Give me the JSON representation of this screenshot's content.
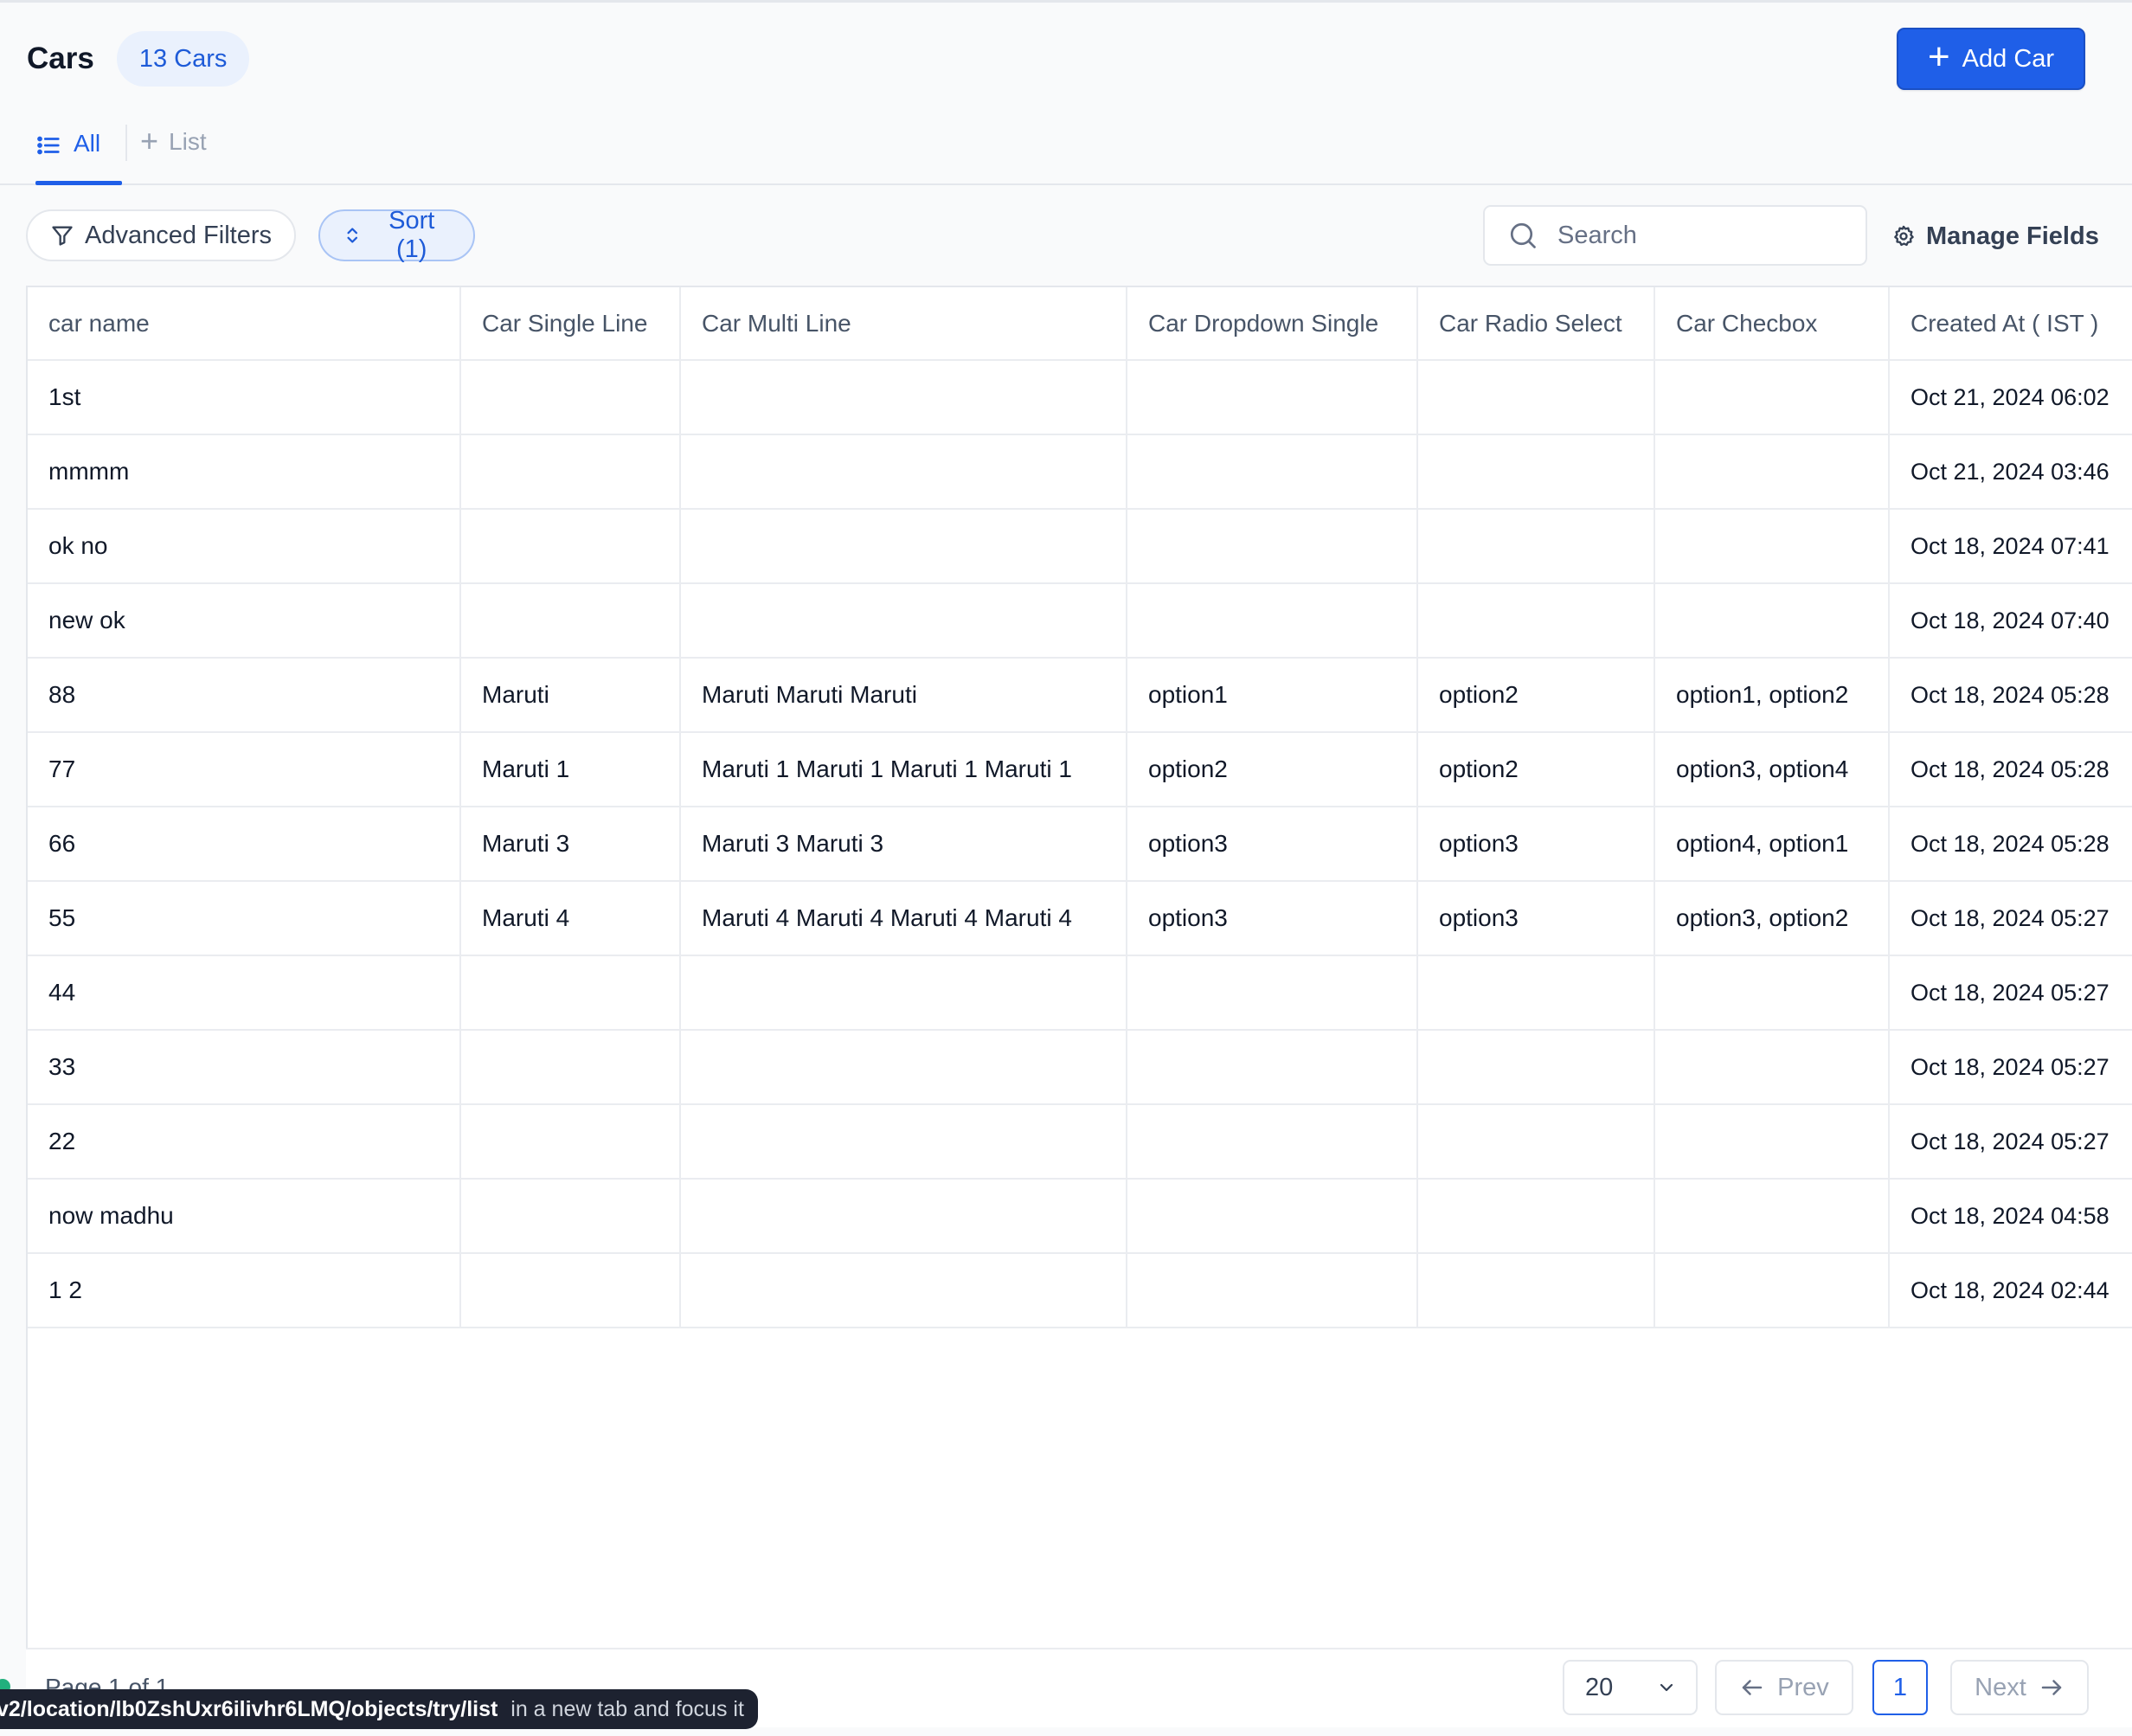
{
  "header": {
    "title": "Cars",
    "count_badge": "13 Cars",
    "add_button": "Add Car"
  },
  "tabs": {
    "all_label": "All",
    "add_list_label": "List"
  },
  "toolbar": {
    "advanced_filters": "Advanced Filters",
    "sort": "Sort (1)",
    "search_placeholder": "Search",
    "manage_fields": "Manage Fields"
  },
  "table": {
    "columns": [
      "car name",
      "Car Single Line",
      "Car Multi Line",
      "Car Dropdown Single",
      "Car Radio Select",
      "Car Checbox",
      "Created At ( IST )"
    ],
    "rows": [
      [
        "1st",
        "",
        "",
        "",
        "",
        "",
        "Oct 21, 2024 06:02"
      ],
      [
        "mmmm",
        "",
        "",
        "",
        "",
        "",
        "Oct 21, 2024 03:46"
      ],
      [
        "ok no",
        "",
        "",
        "",
        "",
        "",
        "Oct 18, 2024 07:41"
      ],
      [
        "new ok",
        "",
        "",
        "",
        "",
        "",
        "Oct 18, 2024 07:40"
      ],
      [
        "88",
        "Maruti",
        "Maruti Maruti Maruti",
        "option1",
        "option2",
        "option1, option2",
        "Oct 18, 2024 05:28"
      ],
      [
        "77",
        "Maruti 1",
        "Maruti 1 Maruti 1 Maruti 1 Maruti 1",
        "option2",
        "option2",
        "option3, option4",
        "Oct 18, 2024 05:28"
      ],
      [
        "66",
        "Maruti 3",
        "Maruti 3 Maruti 3",
        "option3",
        "option3",
        "option4, option1",
        "Oct 18, 2024 05:28"
      ],
      [
        "55",
        "Maruti 4",
        "Maruti 4 Maruti 4 Maruti 4 Maruti 4",
        "option3",
        "option3",
        "option3, option2",
        "Oct 18, 2024 05:27"
      ],
      [
        "44",
        "",
        "",
        "",
        "",
        "",
        "Oct 18, 2024 05:27"
      ],
      [
        "33",
        "",
        "",
        "",
        "",
        "",
        "Oct 18, 2024 05:27"
      ],
      [
        "22",
        "",
        "",
        "",
        "",
        "",
        "Oct 18, 2024 05:27"
      ],
      [
        "now madhu",
        "",
        "",
        "",
        "",
        "",
        "Oct 18, 2024 04:58"
      ],
      [
        "1 2",
        "",
        "",
        "",
        "",
        "",
        "Oct 18, 2024 02:44"
      ]
    ]
  },
  "pagination": {
    "page_info": "Page 1 of 1",
    "per_page": "20",
    "prev": "Prev",
    "current_page": "1",
    "next": "Next"
  },
  "status_bar": {
    "url": "v2/location/lb0ZshUxr6ilivhr6LMQ/objects/try/list",
    "action": "in a new tab and focus it"
  },
  "colors": {
    "accent": "#1f5fe8",
    "badge_bg": "#eaf1fd",
    "status_dot": "#22b07d"
  },
  "icons": {
    "add": "plus-icon",
    "tab_all": "list-icon",
    "filter": "filter-icon",
    "sort": "sort-arrows-icon",
    "search": "search-icon",
    "manage": "gear-icon",
    "dropdown": "chevron-down-icon",
    "prev": "arrow-left-icon",
    "next": "arrow-right-icon"
  }
}
